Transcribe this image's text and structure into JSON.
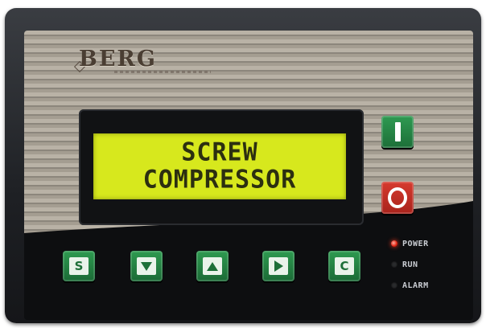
{
  "brand": {
    "logo_text": "BERG"
  },
  "display": {
    "lines": [
      "SCREW",
      "COMPRESSOR"
    ],
    "backlight_color": "#d7e81d"
  },
  "controls": {
    "start_button": {
      "symbol": "I",
      "color": "#2f9a52"
    },
    "stop_button": {
      "symbol": "O",
      "color": "#d63a2e"
    }
  },
  "keypad": {
    "keys": [
      {
        "id": "s",
        "label": "S",
        "icon": "letter-s"
      },
      {
        "id": "down",
        "label": "",
        "icon": "arrow-down-icon"
      },
      {
        "id": "up",
        "label": "",
        "icon": "arrow-up-icon"
      },
      {
        "id": "right",
        "label": "",
        "icon": "arrow-right-icon"
      },
      {
        "id": "c",
        "label": "C",
        "icon": "letter-c"
      }
    ],
    "color": "#2e9a50"
  },
  "indicators": [
    {
      "label": "POWER",
      "state": "on",
      "color": "#e02010"
    },
    {
      "label": "RUN",
      "state": "off"
    },
    {
      "label": "ALARM",
      "state": "off"
    }
  ]
}
